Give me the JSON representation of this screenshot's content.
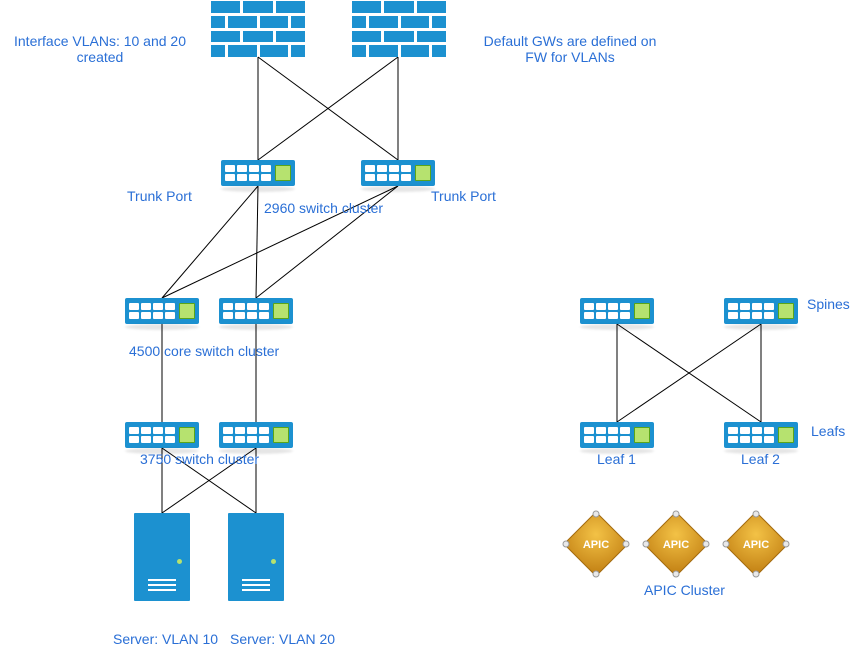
{
  "colors": {
    "text": "#2a6fd6",
    "device_blue": "#1c91d0",
    "chip_green": "#b6e26f",
    "apic_gold_light": "#f3c246",
    "apic_gold_dark": "#c07d11",
    "line": "#000000"
  },
  "labels": {
    "vlan_interfaces": "Interface VLANs: 10 and 20\ncreated",
    "default_gw": "Default GWs are defined on\nFW for VLANs",
    "trunk_port_left": "Trunk Port",
    "trunk_port_right": "Trunk Port",
    "cluster_2960": "2960 switch cluster",
    "cluster_4500": "4500 core switch cluster",
    "cluster_3750": "3750 switch cluster",
    "server_vlan10": "Server: VLAN 10",
    "server_vlan20": "Server: VLAN 20",
    "spines": "Spines",
    "leafs": "Leafs",
    "leaf1": "Leaf 1",
    "leaf2": "Leaf 2",
    "apic_cluster": "APIC Cluster",
    "apic_badge": "APIC"
  },
  "devices": {
    "firewalls": [
      {
        "name": "firewall-left"
      },
      {
        "name": "firewall-right"
      }
    ],
    "switches_2960": [
      {
        "name": "sw-2960-left"
      },
      {
        "name": "sw-2960-right"
      }
    ],
    "switches_4500": [
      {
        "name": "sw-4500-left"
      },
      {
        "name": "sw-4500-right"
      }
    ],
    "switches_3750": [
      {
        "name": "sw-3750-left"
      },
      {
        "name": "sw-3750-right"
      }
    ],
    "servers": [
      {
        "name": "server-vlan10",
        "vlan": 10
      },
      {
        "name": "server-vlan20",
        "vlan": 20
      }
    ],
    "spine_switches": [
      {
        "name": "spine-1"
      },
      {
        "name": "spine-2"
      }
    ],
    "leaf_switches": [
      {
        "name": "leaf-1"
      },
      {
        "name": "leaf-2"
      }
    ],
    "apic_nodes": [
      {
        "name": "apic-1"
      },
      {
        "name": "apic-2"
      },
      {
        "name": "apic-3"
      }
    ]
  },
  "connections": {
    "fw_to_2960": [
      [
        "firewall-left",
        "sw-2960-left"
      ],
      [
        "firewall-left",
        "sw-2960-right"
      ],
      [
        "firewall-right",
        "sw-2960-left"
      ],
      [
        "firewall-right",
        "sw-2960-right"
      ]
    ],
    "c2960_to_4500": [
      [
        "sw-2960-left",
        "sw-4500-left"
      ],
      [
        "sw-2960-left",
        "sw-4500-right"
      ],
      [
        "sw-2960-right",
        "sw-4500-left"
      ],
      [
        "sw-2960-right",
        "sw-4500-right"
      ]
    ],
    "c4500_to_3750": [
      [
        "sw-4500-left",
        "sw-3750-left"
      ],
      [
        "sw-4500-right",
        "sw-3750-right"
      ]
    ],
    "c3750_to_servers": [
      [
        "sw-3750-left",
        "server-vlan10"
      ],
      [
        "sw-3750-left",
        "server-vlan20"
      ],
      [
        "sw-3750-right",
        "server-vlan10"
      ],
      [
        "sw-3750-right",
        "server-vlan20"
      ]
    ],
    "spine_to_leaf": [
      [
        "spine-1",
        "leaf-1"
      ],
      [
        "spine-1",
        "leaf-2"
      ],
      [
        "spine-2",
        "leaf-1"
      ],
      [
        "spine-2",
        "leaf-2"
      ]
    ]
  }
}
